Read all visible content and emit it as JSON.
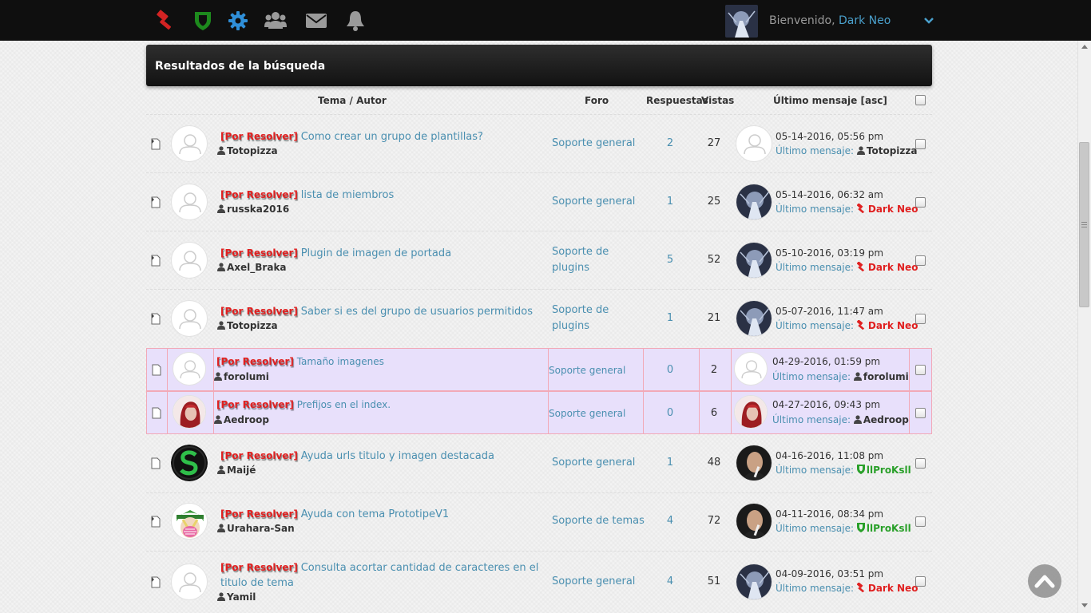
{
  "topbar": {
    "icons": [
      "gavel-icon",
      "shield-icon",
      "gear-icon",
      "users-icon",
      "envelope-icon",
      "bell-icon"
    ],
    "welcome_text": "Bienvenido,",
    "username": "Dark Neo"
  },
  "panel": {
    "title": "Resultados de la búsqueda"
  },
  "columns": {
    "topic": "Tema / Autor",
    "forum": "Foro",
    "replies": "Respuestas",
    "views": "Vistas",
    "last": "Último mensaje [asc]"
  },
  "rows": [
    {
      "prefix": "[Por Resolver]",
      "title": "Como crear un grupo de plantillas?",
      "author": "Totopizza",
      "forum": "Soporte general",
      "replies": "2",
      "views": "27",
      "date": "05-14-2016, 05:56 pm",
      "last_label": "Último mensaje:",
      "last_user": "Totopizza"
    },
    {
      "prefix": "[Por Resolver]",
      "title": "lista de miembros",
      "author": "russka2016",
      "forum": "Soporte general",
      "replies": "1",
      "views": "25",
      "date": "05-14-2016, 06:32 am",
      "last_label": "Último mensaje:",
      "last_user": "Dark Neo"
    },
    {
      "prefix": "[Por Resolver]",
      "title": "Plugin de imagen de portada",
      "author": "Axel_Braka",
      "forum": "Soporte de plugins",
      "replies": "5",
      "views": "52",
      "date": "05-10-2016, 03:19 pm",
      "last_label": "Último mensaje:",
      "last_user": "Dark Neo"
    },
    {
      "prefix": "[Por Resolver]",
      "title": "Saber si es del grupo de usuarios permitidos",
      "author": "Totopizza",
      "forum": "Soporte de plugins",
      "replies": "1",
      "views": "21",
      "date": "05-07-2016, 11:47 am",
      "last_label": "Último mensaje:",
      "last_user": "Dark Neo"
    },
    {
      "prefix": "[Por Resolver]",
      "title": "Tamaño imagenes",
      "author": "forolumi",
      "forum": "Soporte general",
      "replies": "0",
      "views": "2",
      "date": "04-29-2016, 01:59 pm",
      "last_label": "Último mensaje:",
      "last_user": "forolumi"
    },
    {
      "prefix": "[Por Resolver]",
      "title": "Prefijos en el index.",
      "author": "Aedroop",
      "forum": "Soporte general",
      "replies": "0",
      "views": "6",
      "date": "04-27-2016, 09:43 pm",
      "last_label": "Último mensaje:",
      "last_user": "Aedroop"
    },
    {
      "prefix": "[Por Resolver]",
      "title": "Ayuda urls titulo y imagen destacada",
      "author": "Maijé",
      "forum": "Soporte general",
      "replies": "1",
      "views": "48",
      "date": "04-16-2016, 11:08 pm",
      "last_label": "Último mensaje:",
      "last_user": "llProKsll"
    },
    {
      "prefix": "[Por Resolver]",
      "title": "Ayuda con tema PrototipeV1",
      "author": "Urahara-San",
      "forum": "Soporte de temas",
      "replies": "4",
      "views": "72",
      "date": "04-11-2016, 08:34 pm",
      "last_label": "Último mensaje:",
      "last_user": "llProKsll"
    },
    {
      "prefix": "[Por Resolver]",
      "title": "Consulta acortar cantidad de caracteres en el titulo de tema",
      "author": "Yamil",
      "forum": "Soporte general",
      "replies": "4",
      "views": "51",
      "date": "04-09-2016, 03:51 pm",
      "last_label": "Último mensaje:",
      "last_user": "Dark Neo"
    }
  ],
  "colors": {
    "accent": "#4a8fb0",
    "prefix": "#e02020",
    "admin": "#e02020",
    "moderator": "#2aa02a",
    "highlight": "#e8e0fb"
  }
}
